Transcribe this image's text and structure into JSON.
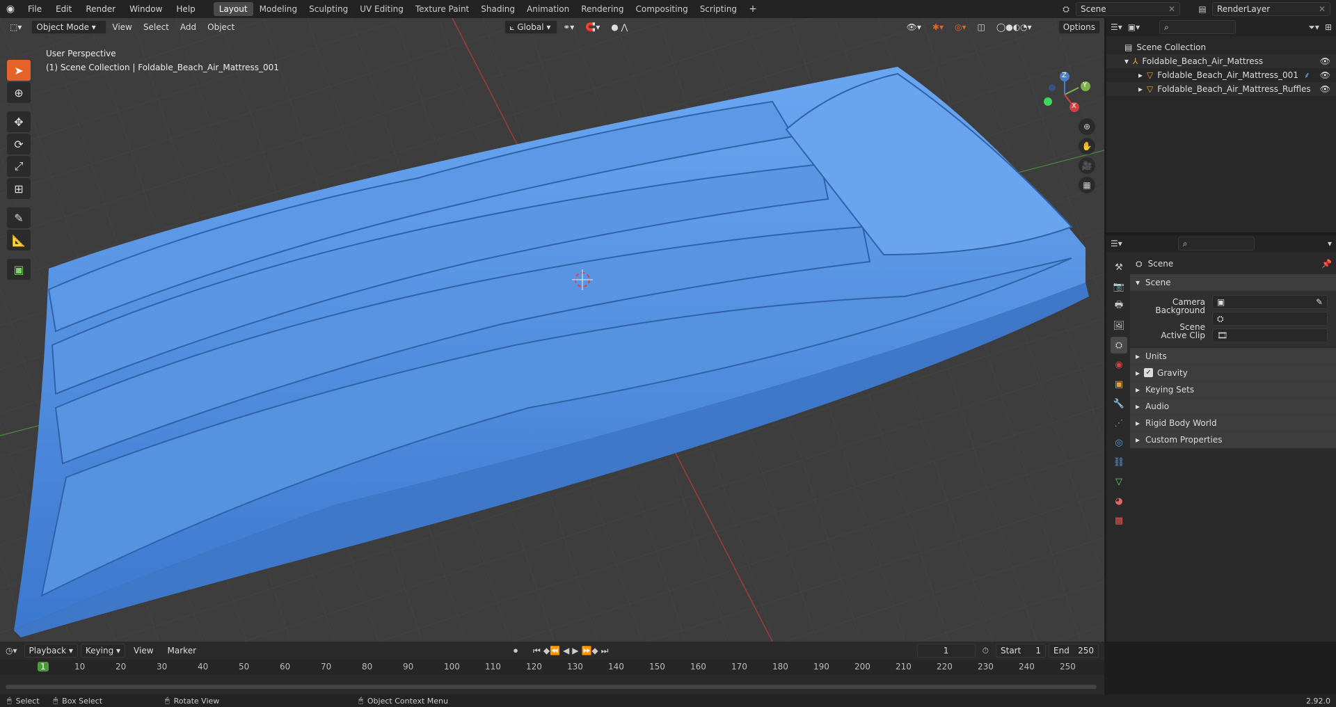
{
  "topbar": {
    "menus": [
      "File",
      "Edit",
      "Render",
      "Window",
      "Help"
    ],
    "workspaces": [
      "Layout",
      "Modeling",
      "Sculpting",
      "UV Editing",
      "Texture Paint",
      "Shading",
      "Animation",
      "Rendering",
      "Compositing",
      "Scripting"
    ],
    "active_workspace": "Layout",
    "scene_name": "Scene",
    "view_layer": "RenderLayer",
    "add_tab": "+"
  },
  "viewport": {
    "mode": "Object Mode",
    "menus": [
      "View",
      "Select",
      "Add",
      "Object"
    ],
    "transform_orientation": "Global",
    "options": "Options",
    "overlay_text_1": "User Perspective",
    "overlay_text_2": "(1) Scene Collection | Foldable_Beach_Air_Mattress_001",
    "gizmo": {
      "x": "X",
      "y": "Y",
      "z": "Z"
    }
  },
  "outliner": {
    "root": "Scene Collection",
    "items": [
      {
        "label": "Foldable_Beach_Air_Mattress"
      },
      {
        "label": "Foldable_Beach_Air_Mattress_001"
      },
      {
        "label": "Foldable_Beach_Air_Mattress_Ruffles"
      }
    ]
  },
  "properties": {
    "context": "Scene",
    "panel_title": "Scene",
    "fields": [
      {
        "label": "Camera"
      },
      {
        "label": "Background Scene"
      },
      {
        "label": "Active Clip"
      }
    ],
    "subpanels": [
      "Units",
      "Gravity",
      "Keying Sets",
      "Audio",
      "Rigid Body World",
      "Custom Properties"
    ]
  },
  "timeline": {
    "menus": [
      "Playback",
      "Keying",
      "View",
      "Marker"
    ],
    "current_frame": "1",
    "start_label": "Start",
    "start": "1",
    "end_label": "End",
    "end": "250",
    "ticks": [
      "1",
      "10",
      "20",
      "30",
      "40",
      "50",
      "60",
      "70",
      "80",
      "90",
      "100",
      "110",
      "120",
      "130",
      "140",
      "150",
      "160",
      "170",
      "180",
      "190",
      "200",
      "210",
      "220",
      "230",
      "240",
      "250"
    ]
  },
  "statusbar": {
    "select": "Select",
    "box_select": "Box Select",
    "rotate_view": "Rotate View",
    "context_menu": "Object Context Menu",
    "version": "2.92.0"
  },
  "colors": {
    "accent": "#e5622a",
    "mattress": "#4f8fe0",
    "active_tab": "#4a4a4a",
    "frame_marker": "#4b9a3b"
  }
}
